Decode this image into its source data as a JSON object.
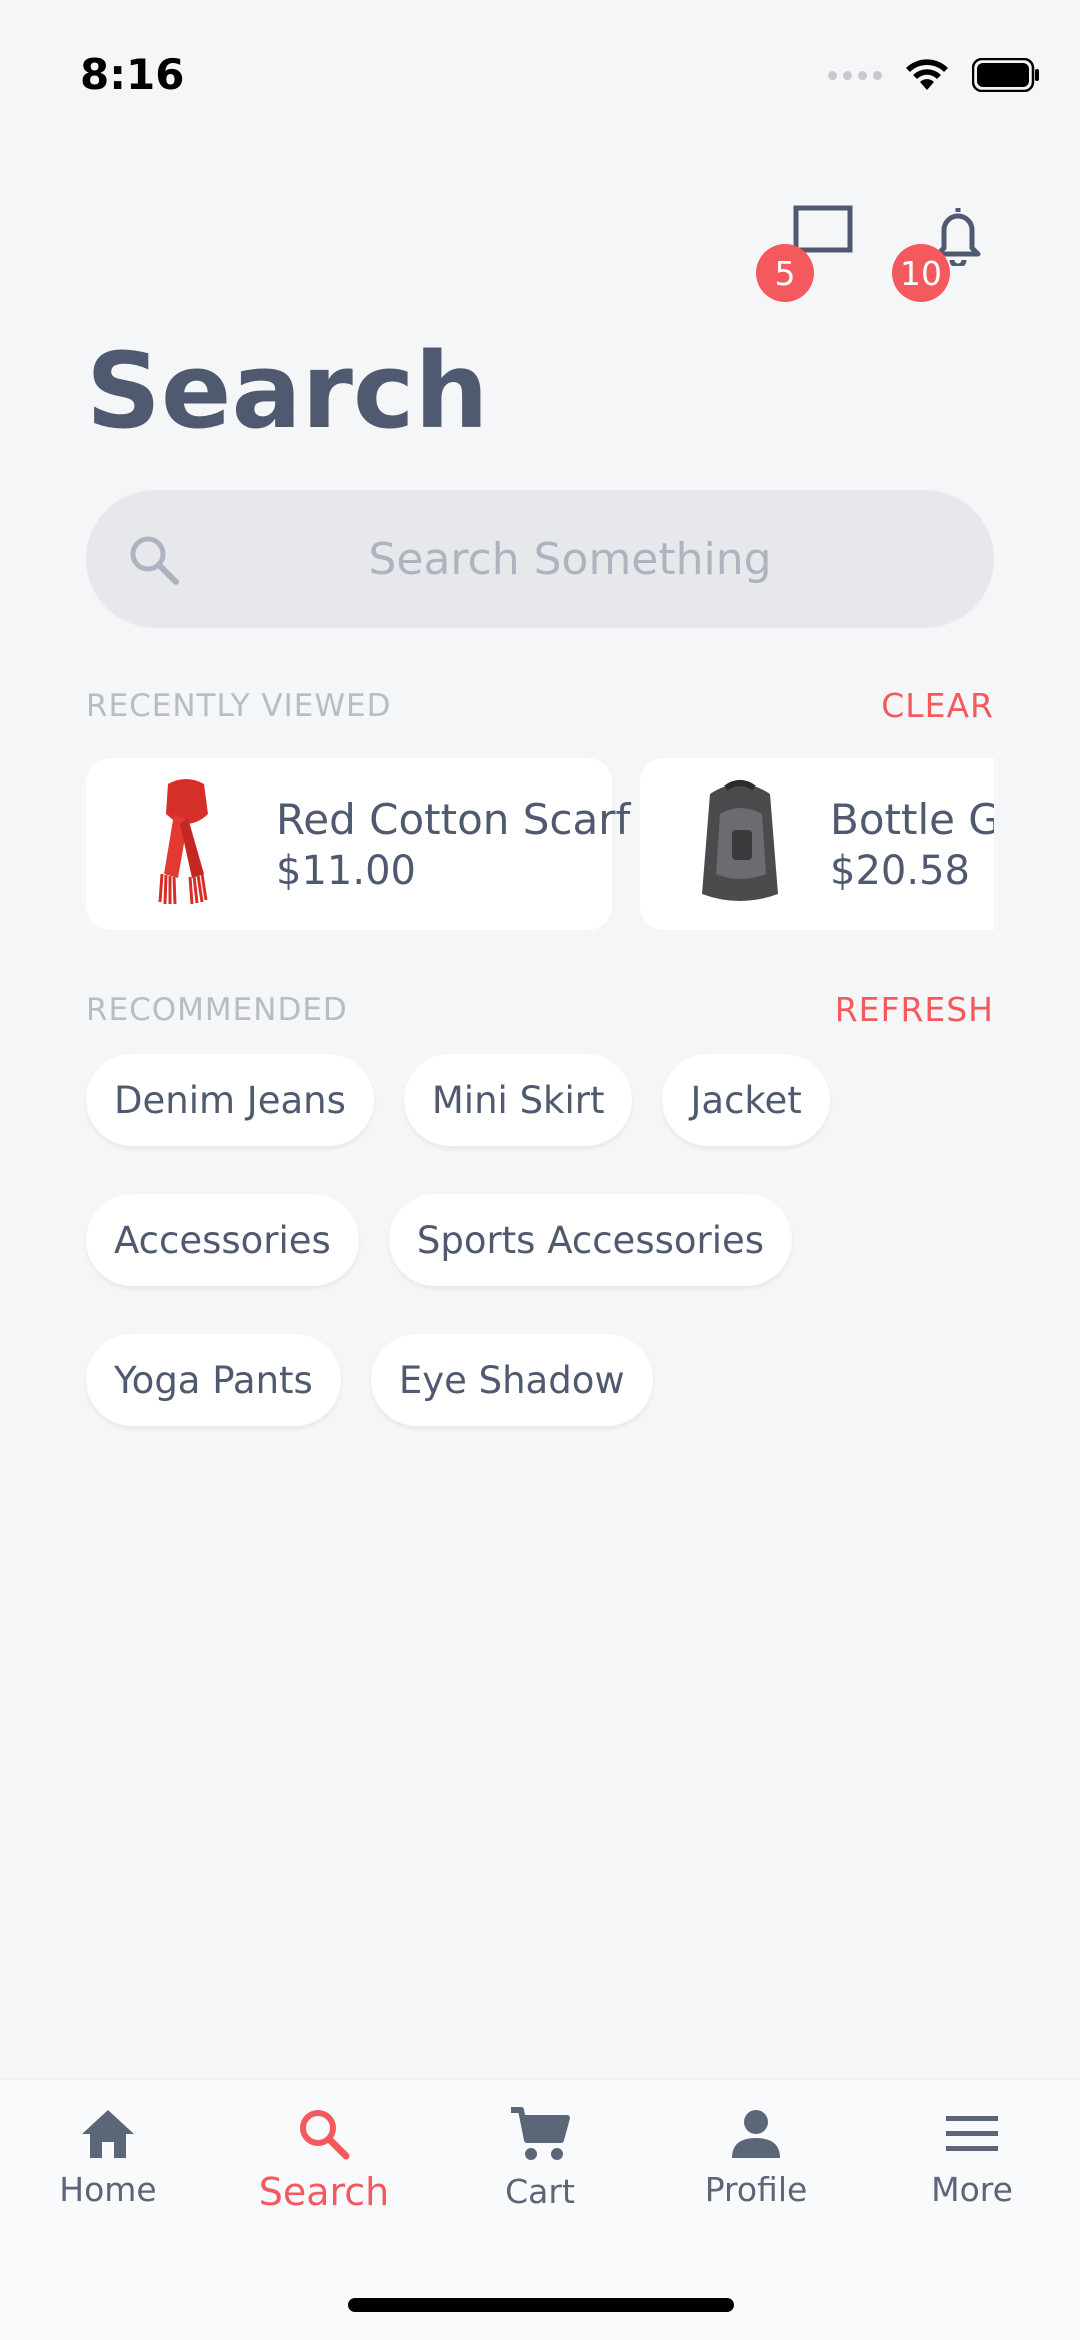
{
  "status_bar": {
    "time": "8:16"
  },
  "header": {
    "messages_badge": "5",
    "notifications_badge": "10"
  },
  "page_title": "Search",
  "search": {
    "placeholder": "Search Something",
    "value": ""
  },
  "recently_viewed": {
    "label": "RECENTLY VIEWED",
    "action": "CLEAR",
    "items": [
      {
        "name": "Red Cotton Scarf",
        "price": "$11.00",
        "thumb": "red-scarf"
      },
      {
        "name": "Bottle Gre",
        "price": "$20.58",
        "thumb": "gray-backpack"
      }
    ]
  },
  "recommended": {
    "label": "RECOMMENDED",
    "action": "REFRESH",
    "rows": [
      [
        "Denim Jeans",
        "Mini Skirt",
        "Jacket"
      ],
      [
        "Accessories",
        "Sports Accessories"
      ],
      [
        "Yoga Pants",
        "Eye Shadow"
      ]
    ]
  },
  "tab_bar": {
    "active": "search",
    "tabs": [
      {
        "label": "Home",
        "icon": "home-icon"
      },
      {
        "label": "Search",
        "icon": "search-icon"
      },
      {
        "label": "Cart",
        "icon": "cart-icon"
      },
      {
        "label": "Profile",
        "icon": "profile-icon"
      },
      {
        "label": "More",
        "icon": "menu-icon"
      }
    ]
  },
  "colors": {
    "accent": "#f4595d",
    "text": "#4f5a70",
    "muted": "#b7bcc5",
    "background": "#f5f6f8"
  }
}
